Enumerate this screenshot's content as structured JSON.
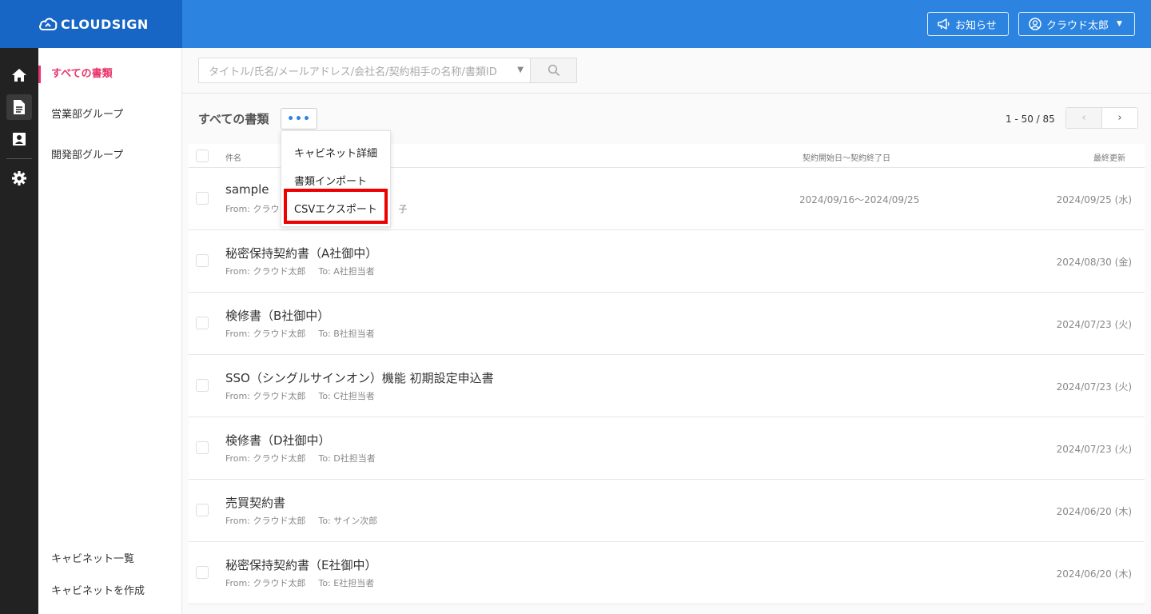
{
  "brand": {
    "name": "CLOUDSIGN"
  },
  "header": {
    "notice_label": "お知らせ",
    "user_label": "クラウド太郎",
    "caret": "▼"
  },
  "rail": {
    "items": [
      "home-icon",
      "document-icon",
      "contacts-icon",
      "settings-icon"
    ]
  },
  "folders": {
    "items": [
      "すべての書類",
      "営業部グループ",
      "開発部グループ"
    ],
    "footer": [
      "キャビネット一覧",
      "キャビネットを作成"
    ]
  },
  "search": {
    "placeholder": "タイトル/氏名/メールアドレス/会社名/契約相手の名称/書類ID",
    "caret": "▼"
  },
  "list": {
    "title": "すべての書類",
    "more_label": "•••",
    "pager_text": "1 - 50 / 85",
    "prev": "‹",
    "next": "›"
  },
  "table": {
    "columns": [
      "件名",
      "契約開始日〜契約終了日",
      "最終更新"
    ],
    "rows": [
      {
        "title": "sample",
        "from": "From: クラウド",
        "to": "子",
        "period": "2024/09/16〜2024/09/25",
        "updated": "2024/09/25 (水)"
      },
      {
        "title": "秘密保持契約書（A社御中）",
        "from": "From: クラウド太郎",
        "to": "To: A社担当者",
        "period": "",
        "updated": "2024/08/30 (金)"
      },
      {
        "title": "検修書（B社御中）",
        "from": "From: クラウド太郎",
        "to": "To: B社担当者",
        "period": "",
        "updated": "2024/07/23 (火)"
      },
      {
        "title": "SSO（シングルサインオン）機能 初期設定申込書",
        "from": "From: クラウド太郎",
        "to": "To: C社担当者",
        "period": "",
        "updated": "2024/07/23 (火)"
      },
      {
        "title": "検修書（D社御中）",
        "from": "From: クラウド太郎",
        "to": "To: D社担当者",
        "period": "",
        "updated": "2024/07/23 (火)"
      },
      {
        "title": "売買契約書",
        "from": "From: クラウド太郎",
        "to": "To: サイン次郎",
        "period": "",
        "updated": "2024/06/20 (木)"
      },
      {
        "title": "秘密保持契約書（E社御中）",
        "from": "From: クラウド太郎",
        "to": "To: E社担当者",
        "period": "",
        "updated": "2024/06/20 (木)"
      }
    ]
  },
  "dropdown": {
    "items": [
      "キャビネット詳細",
      "書類インポート",
      "CSVエクスポート"
    ],
    "highlighted": "CSVエクスポート"
  },
  "colors": {
    "brand": "#1766c6",
    "header": "#2c84e0",
    "active_folder": "#e8336b",
    "highlight": "#e00000"
  }
}
